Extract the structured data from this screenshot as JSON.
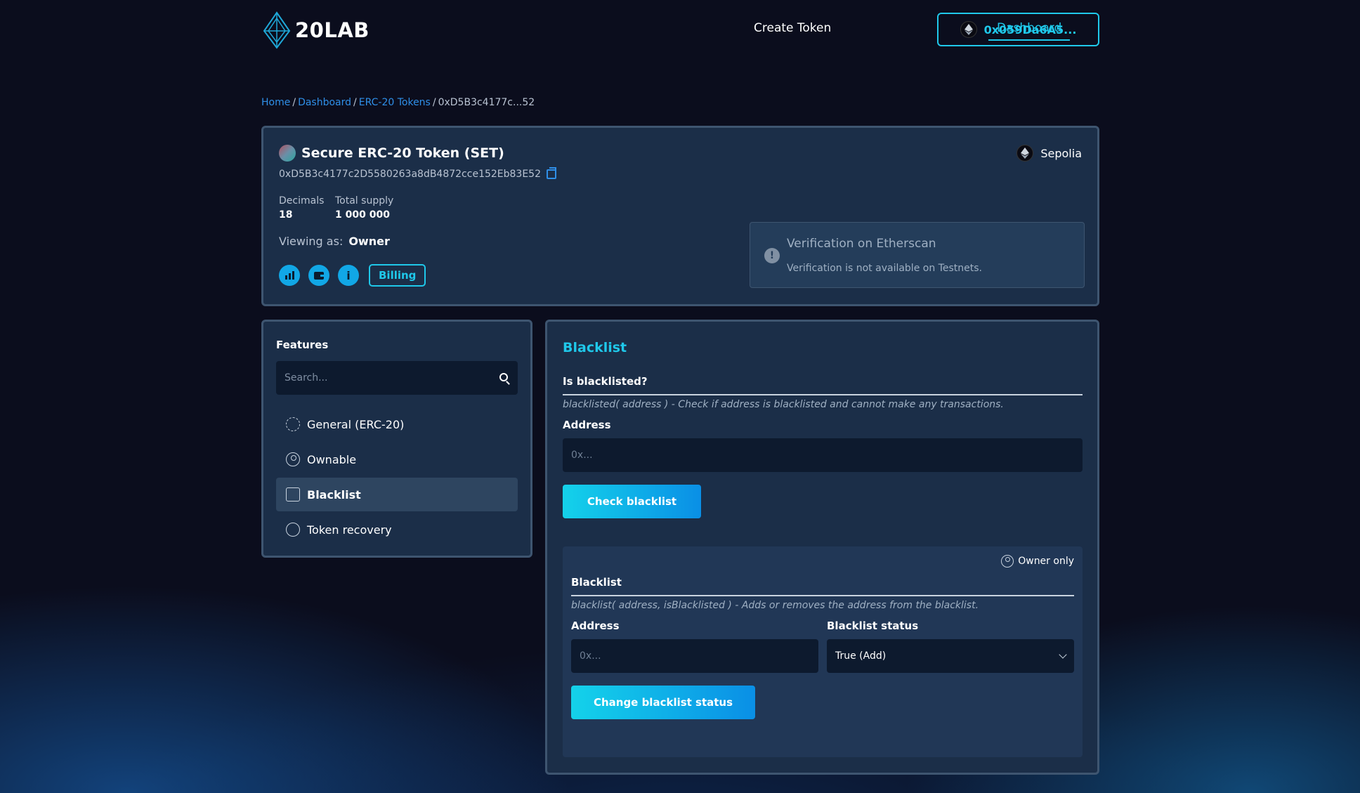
{
  "header": {
    "logo_text": "20LAB",
    "nav_create": "Create Token",
    "nav_dashboard": "Dashboard",
    "wallet_address": "0x059Da6A5..."
  },
  "breadcrumb": {
    "home": "Home",
    "dashboard": "Dashboard",
    "erc20": "ERC-20 Tokens",
    "current": "0xD5B3c4177c...52",
    "separator": "/"
  },
  "token": {
    "name": "Secure ERC-20 Token (SET)",
    "address": "0xD5B3c4177c2D5580263a8dB4872cce152Eb83E52",
    "decimals_label": "Decimals",
    "decimals_value": "18",
    "supply_label": "Total supply",
    "supply_value": "1 000 000",
    "viewing_label": "Viewing as:",
    "viewing_value": "Owner",
    "billing_label": "Billing",
    "network": "Sepolia",
    "verify_title": "Verification on Etherscan",
    "verify_text": "Verification is not available on Testnets."
  },
  "features": {
    "title": "Features",
    "search_placeholder": "Search...",
    "items": [
      {
        "label": "General (ERC-20)",
        "icon": "gear-icon",
        "active": false
      },
      {
        "label": "Ownable",
        "icon": "user-icon",
        "active": false
      },
      {
        "label": "Blacklist",
        "icon": "document-icon",
        "active": true
      },
      {
        "label": "Token recovery",
        "icon": "recovery-icon",
        "active": false
      }
    ]
  },
  "blacklist": {
    "title": "Blacklist",
    "check": {
      "title": "Is blacklisted?",
      "description": "blacklisted( address ) - Check if address is blacklisted and cannot make any transactions.",
      "address_label": "Address",
      "address_placeholder": "0x...",
      "button": "Check blacklist"
    },
    "change": {
      "owner_only": "Owner only",
      "title": "Blacklist",
      "description": "blacklist( address, isBlacklisted ) - Adds or removes the address from the blacklist.",
      "address_label": "Address",
      "address_placeholder": "0x...",
      "status_label": "Blacklist status",
      "status_value": "True (Add)",
      "button": "Change blacklist status"
    }
  },
  "colors": {
    "accent": "#1fc8ea",
    "link": "#2f8fe8",
    "panel": "#1b2e48",
    "background": "#0b0d1d"
  }
}
